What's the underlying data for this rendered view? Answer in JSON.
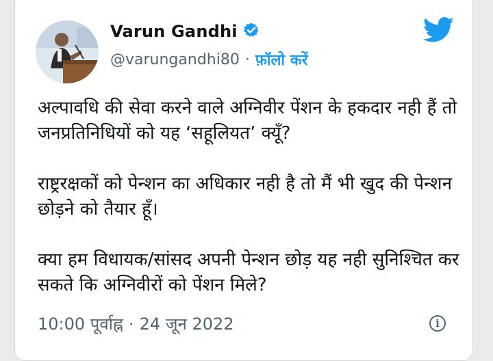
{
  "author": {
    "name": "Varun Gandhi",
    "handle": "@varungandhi80",
    "separator": "·",
    "follow_label": "फ़ॉलो करें",
    "verified": true
  },
  "tweet": {
    "paragraphs": [
      "अल्पावधि की सेवा करने वाले अग्निवीर पेंशन के हकदार नही हैं तो जनप्रतिनिधियों को यह ‘सहूलियत’ क्यूँ?",
      "राष्ट्ररक्षकों को पेन्शन का अधिकार नही है तो मैं भी खुद की पेन्शन छोड़ने को तैयार हूँ।",
      "क्या हम विधायक/सांसद अपनी पेन्शन छोड़ यह नही सुनिश्चित कर सकते कि अग्निवीरों को पेंशन मिले?"
    ],
    "time": "10:00 पूर्वाह्न",
    "meta_separator": "·",
    "date": "24 जून 2022"
  },
  "icons": {
    "brand": "twitter-bird-icon",
    "verified": "verified-badge-icon",
    "info": "info-icon"
  },
  "colors": {
    "brand": "#1d9bf0",
    "text": "#0f1419",
    "secondary": "#536471",
    "background": "#ffffff"
  }
}
